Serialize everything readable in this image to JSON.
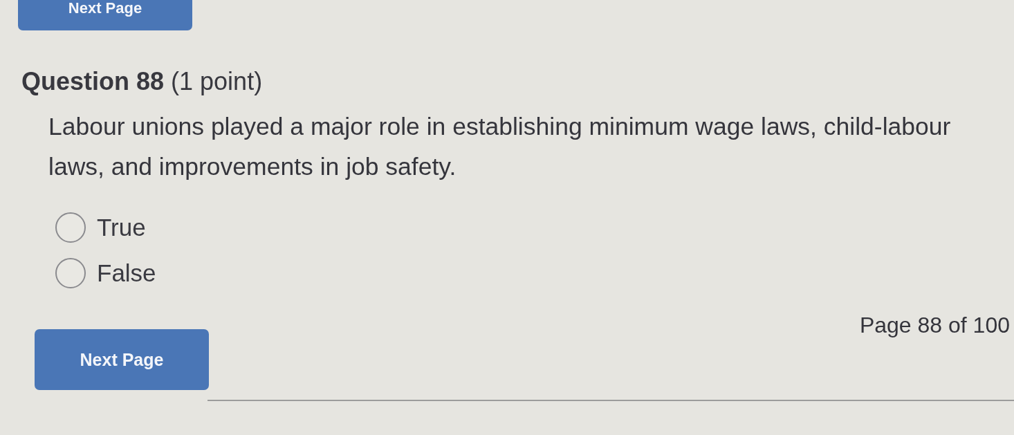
{
  "top_button": {
    "label": "Next Page"
  },
  "question": {
    "title": "**Question 88** (1 point)",
    "text": "Labour unions played a major role in establishing minimum wage laws, child-labour laws, and improvements in job safety."
  },
  "options": [
    {
      "label": "True",
      "selected": false
    },
    {
      "label": "False",
      "selected": false
    }
  ],
  "footer": {
    "page_indicator": "Page 88 of 100",
    "button": {
      "label": "Next Page"
    }
  }
}
